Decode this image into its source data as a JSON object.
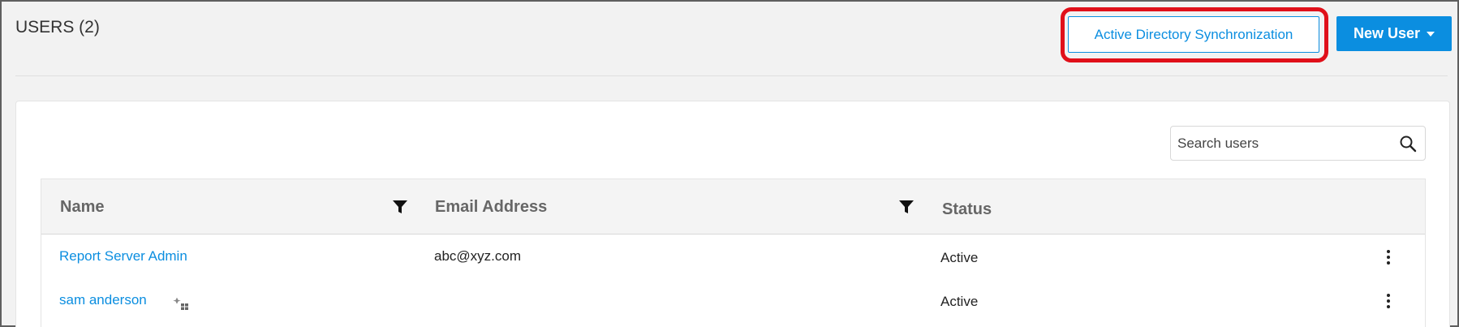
{
  "header": {
    "title": "USERS (2)",
    "ad_sync_label": "Active Directory Synchronization",
    "new_user_label": "New User"
  },
  "search": {
    "placeholder": "Search users"
  },
  "table": {
    "columns": [
      "Name",
      "Email Address",
      "Status"
    ],
    "rows": [
      {
        "name": "Report Server Admin",
        "email": "abc@xyz.com",
        "status": "Active"
      },
      {
        "name": "sam anderson",
        "email": "",
        "status": "Active"
      }
    ]
  },
  "colors": {
    "accent": "#0b8ee0",
    "highlight": "#e0101a",
    "background": "#f2f2f2"
  },
  "icons": [
    "caret-down-icon",
    "search-icon",
    "filter-icon",
    "kebab-menu-icon",
    "ad-sync-user-icon"
  ]
}
